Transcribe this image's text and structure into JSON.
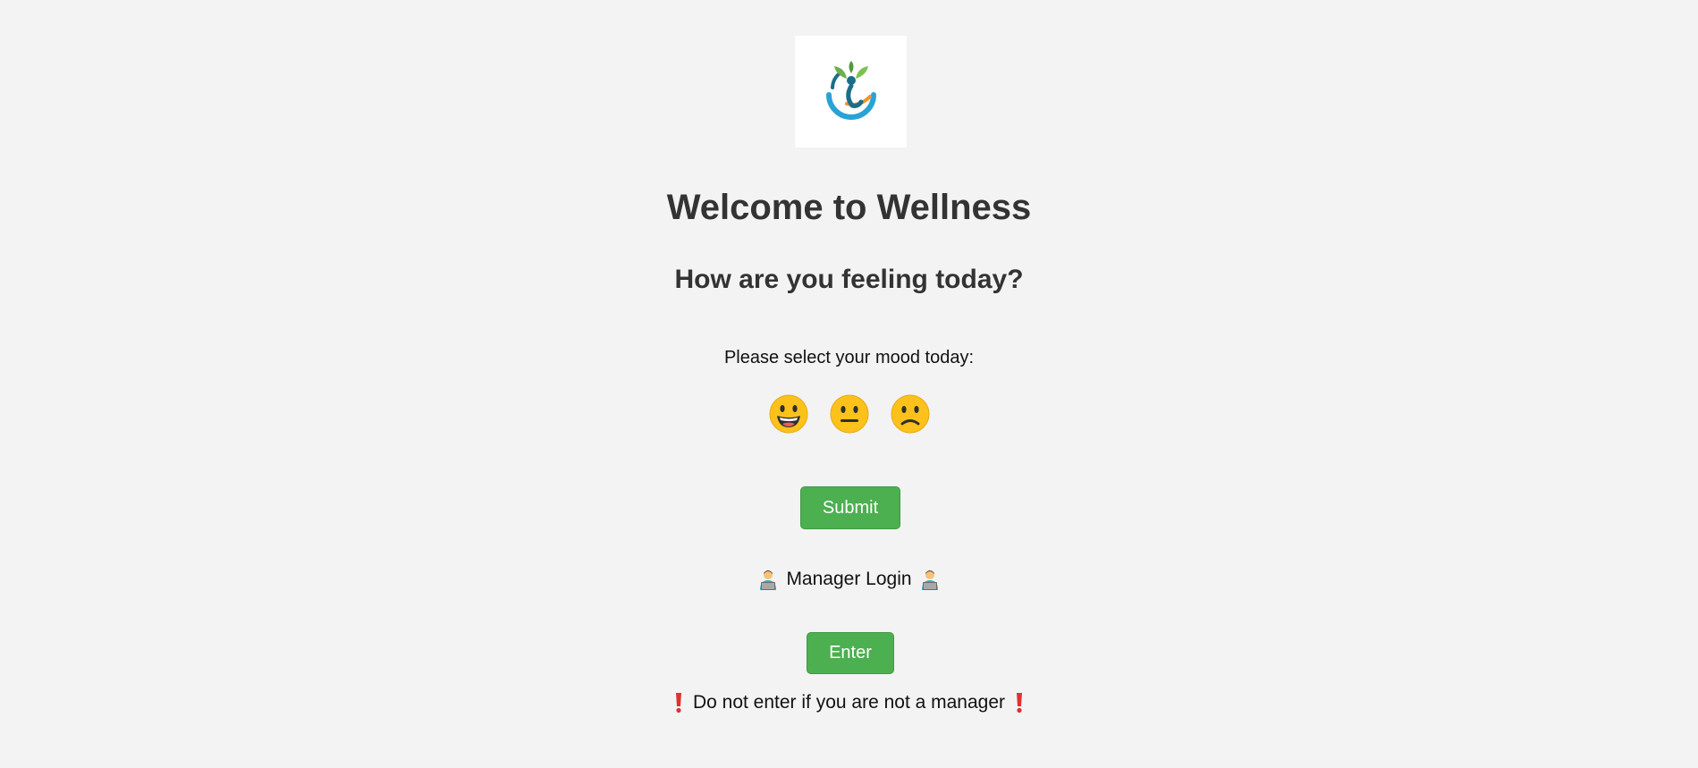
{
  "logo": {
    "icon": "wellness-person-leaves-logo",
    "colors": {
      "leaf": "#6ab04c",
      "person": "#1b6e8a",
      "swoosh": "#29a3d6",
      "orange": "#f0932b"
    }
  },
  "heading": {
    "title": "Welcome to Wellness",
    "subtitle": "How are you feeling today?"
  },
  "mood": {
    "prompt": "Please select your mood today:",
    "options": [
      {
        "icon": "happy-face-icon"
      },
      {
        "icon": "neutral-face-icon"
      },
      {
        "icon": "sad-face-icon"
      }
    ]
  },
  "actions": {
    "submit_label": "Submit",
    "enter_label": "Enter"
  },
  "manager": {
    "label": "Manager Login",
    "icon": "person-at-laptop-icon"
  },
  "warning": {
    "text": "Do not enter if you are not a manager",
    "icon": "exclamation-icon"
  },
  "colors": {
    "button": "#4caf50",
    "background": "#f3f3f3",
    "heading": "#333333",
    "warning": "#e03131"
  }
}
